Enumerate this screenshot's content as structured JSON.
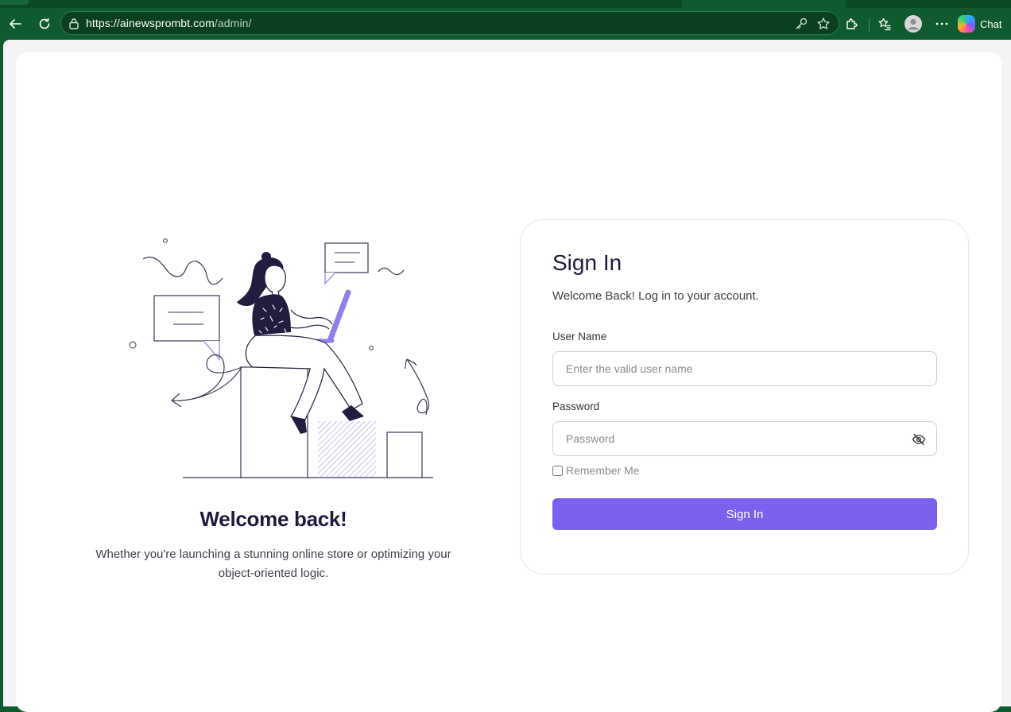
{
  "browser": {
    "url_host": "https://ainewsprombt.com",
    "url_path": "/admin/",
    "chat_label": "Chat"
  },
  "welcome": {
    "title": "Welcome back!",
    "text": "Whether you're launching a stunning online store or optimizing your object-oriented logic."
  },
  "signin": {
    "title": "Sign In",
    "subtitle": "Welcome Back! Log in to your account.",
    "username_label": "User Name",
    "username_placeholder": "Enter the valid user name",
    "password_label": "Password",
    "password_placeholder": "Password",
    "remember_label": "Remember Me",
    "submit_label": "Sign In"
  },
  "colors": {
    "accent": "#7b61ed",
    "heading": "#1f1a3d",
    "browser_frame": "#0f5a2e"
  }
}
